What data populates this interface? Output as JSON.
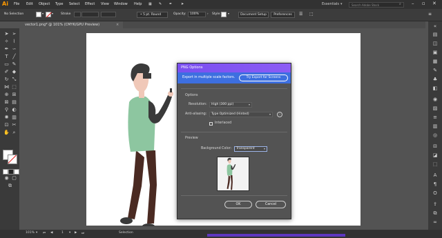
{
  "app": {
    "logo": "Ai"
  },
  "menu": [
    "File",
    "Edit",
    "Object",
    "Type",
    "Select",
    "Effect",
    "View",
    "Window",
    "Help"
  ],
  "workspace": {
    "label": "Essentials"
  },
  "search": {
    "placeholder": "Search Adobe Stock"
  },
  "controlbar": {
    "selection_label": "No Selection",
    "stroke_label": "Stroke",
    "brush_label": "5 pt. Round",
    "opacity_label": "Opacity:",
    "opacity_value": "100%",
    "style_label": "Style:",
    "doc_setup": "Document Setup",
    "preferences": "Preferences"
  },
  "document_tab": {
    "title": "vector1.png* @ 101% (CMYK/GPU Preview)",
    "close": "×"
  },
  "statusbar": {
    "zoom": "101%",
    "page": "1",
    "mode": "Selection"
  },
  "dialog": {
    "title": "PNG Options",
    "banner_text": "Export in multiple scale factors.",
    "try_button": "Try Export for Screens",
    "options_heading": "Options",
    "resolution_label": "Resolution:",
    "resolution_value": "High (300 ppi)",
    "antialias_label": "Anti-aliasing:",
    "antialias_value": "Type Optimized (Hinted)",
    "interlaced_label": "Interlaced",
    "interlaced_checked": false,
    "preview_heading": "Preview",
    "bgcolor_label": "Background Color:",
    "bgcolor_value": "Transparent",
    "ok": "OK",
    "cancel": "Cancel"
  },
  "colors": {
    "accent": "#7a4ff0",
    "banner": "#3d6fe0",
    "figure_hair": "#3a3a3a",
    "figure_skin": "#f0c8b8",
    "figure_vest": "#8dc6a0",
    "figure_pants": "#4a2a22"
  }
}
